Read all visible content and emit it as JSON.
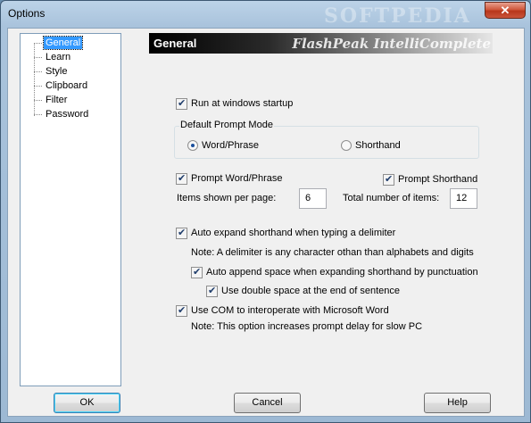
{
  "window": {
    "title": "Options",
    "watermark": "SOFTPEDIA",
    "close_glyph": "✕"
  },
  "tree": {
    "items": [
      "General",
      "Learn",
      "Style",
      "Clipboard",
      "Filter",
      "Password"
    ],
    "selected": "General"
  },
  "header": {
    "title": "General",
    "brand": "FlashPeak IntelliComplete"
  },
  "options": {
    "run_startup": {
      "label": "Run at windows startup",
      "checked": true
    },
    "prompt_mode": {
      "group_label": "Default Prompt Mode",
      "word_phrase": "Word/Phrase",
      "shorthand": "Shorthand",
      "selected": "Word/Phrase"
    },
    "prompt_word": {
      "label": "Prompt Word/Phrase",
      "checked": true
    },
    "prompt_shorthand": {
      "label": "Prompt Shorthand",
      "checked": true
    },
    "items_per_page": {
      "label": "Items shown per page:",
      "value": "6"
    },
    "total_items": {
      "label": "Total number of items:",
      "value": "12"
    },
    "auto_expand": {
      "label": "Auto expand shorthand when typing a delimiter",
      "checked": true
    },
    "delimiter_note": "Note: A delimiter is any character othan than alphabets and digits",
    "auto_append": {
      "label": "Auto append space when expanding shorthand by punctuation",
      "checked": true
    },
    "double_space": {
      "label": "Use double space at the end of sentence",
      "checked": true
    },
    "use_com": {
      "label": "Use COM to interoperate with Microsoft Word",
      "checked": true
    },
    "com_note": "Note: This option increases prompt delay for slow PC"
  },
  "buttons": {
    "ok": "OK",
    "cancel": "Cancel",
    "help": "Help"
  },
  "colors": {
    "selection": "#3399ff",
    "titlebar": "#a9c3dc",
    "close": "#c9533a"
  }
}
